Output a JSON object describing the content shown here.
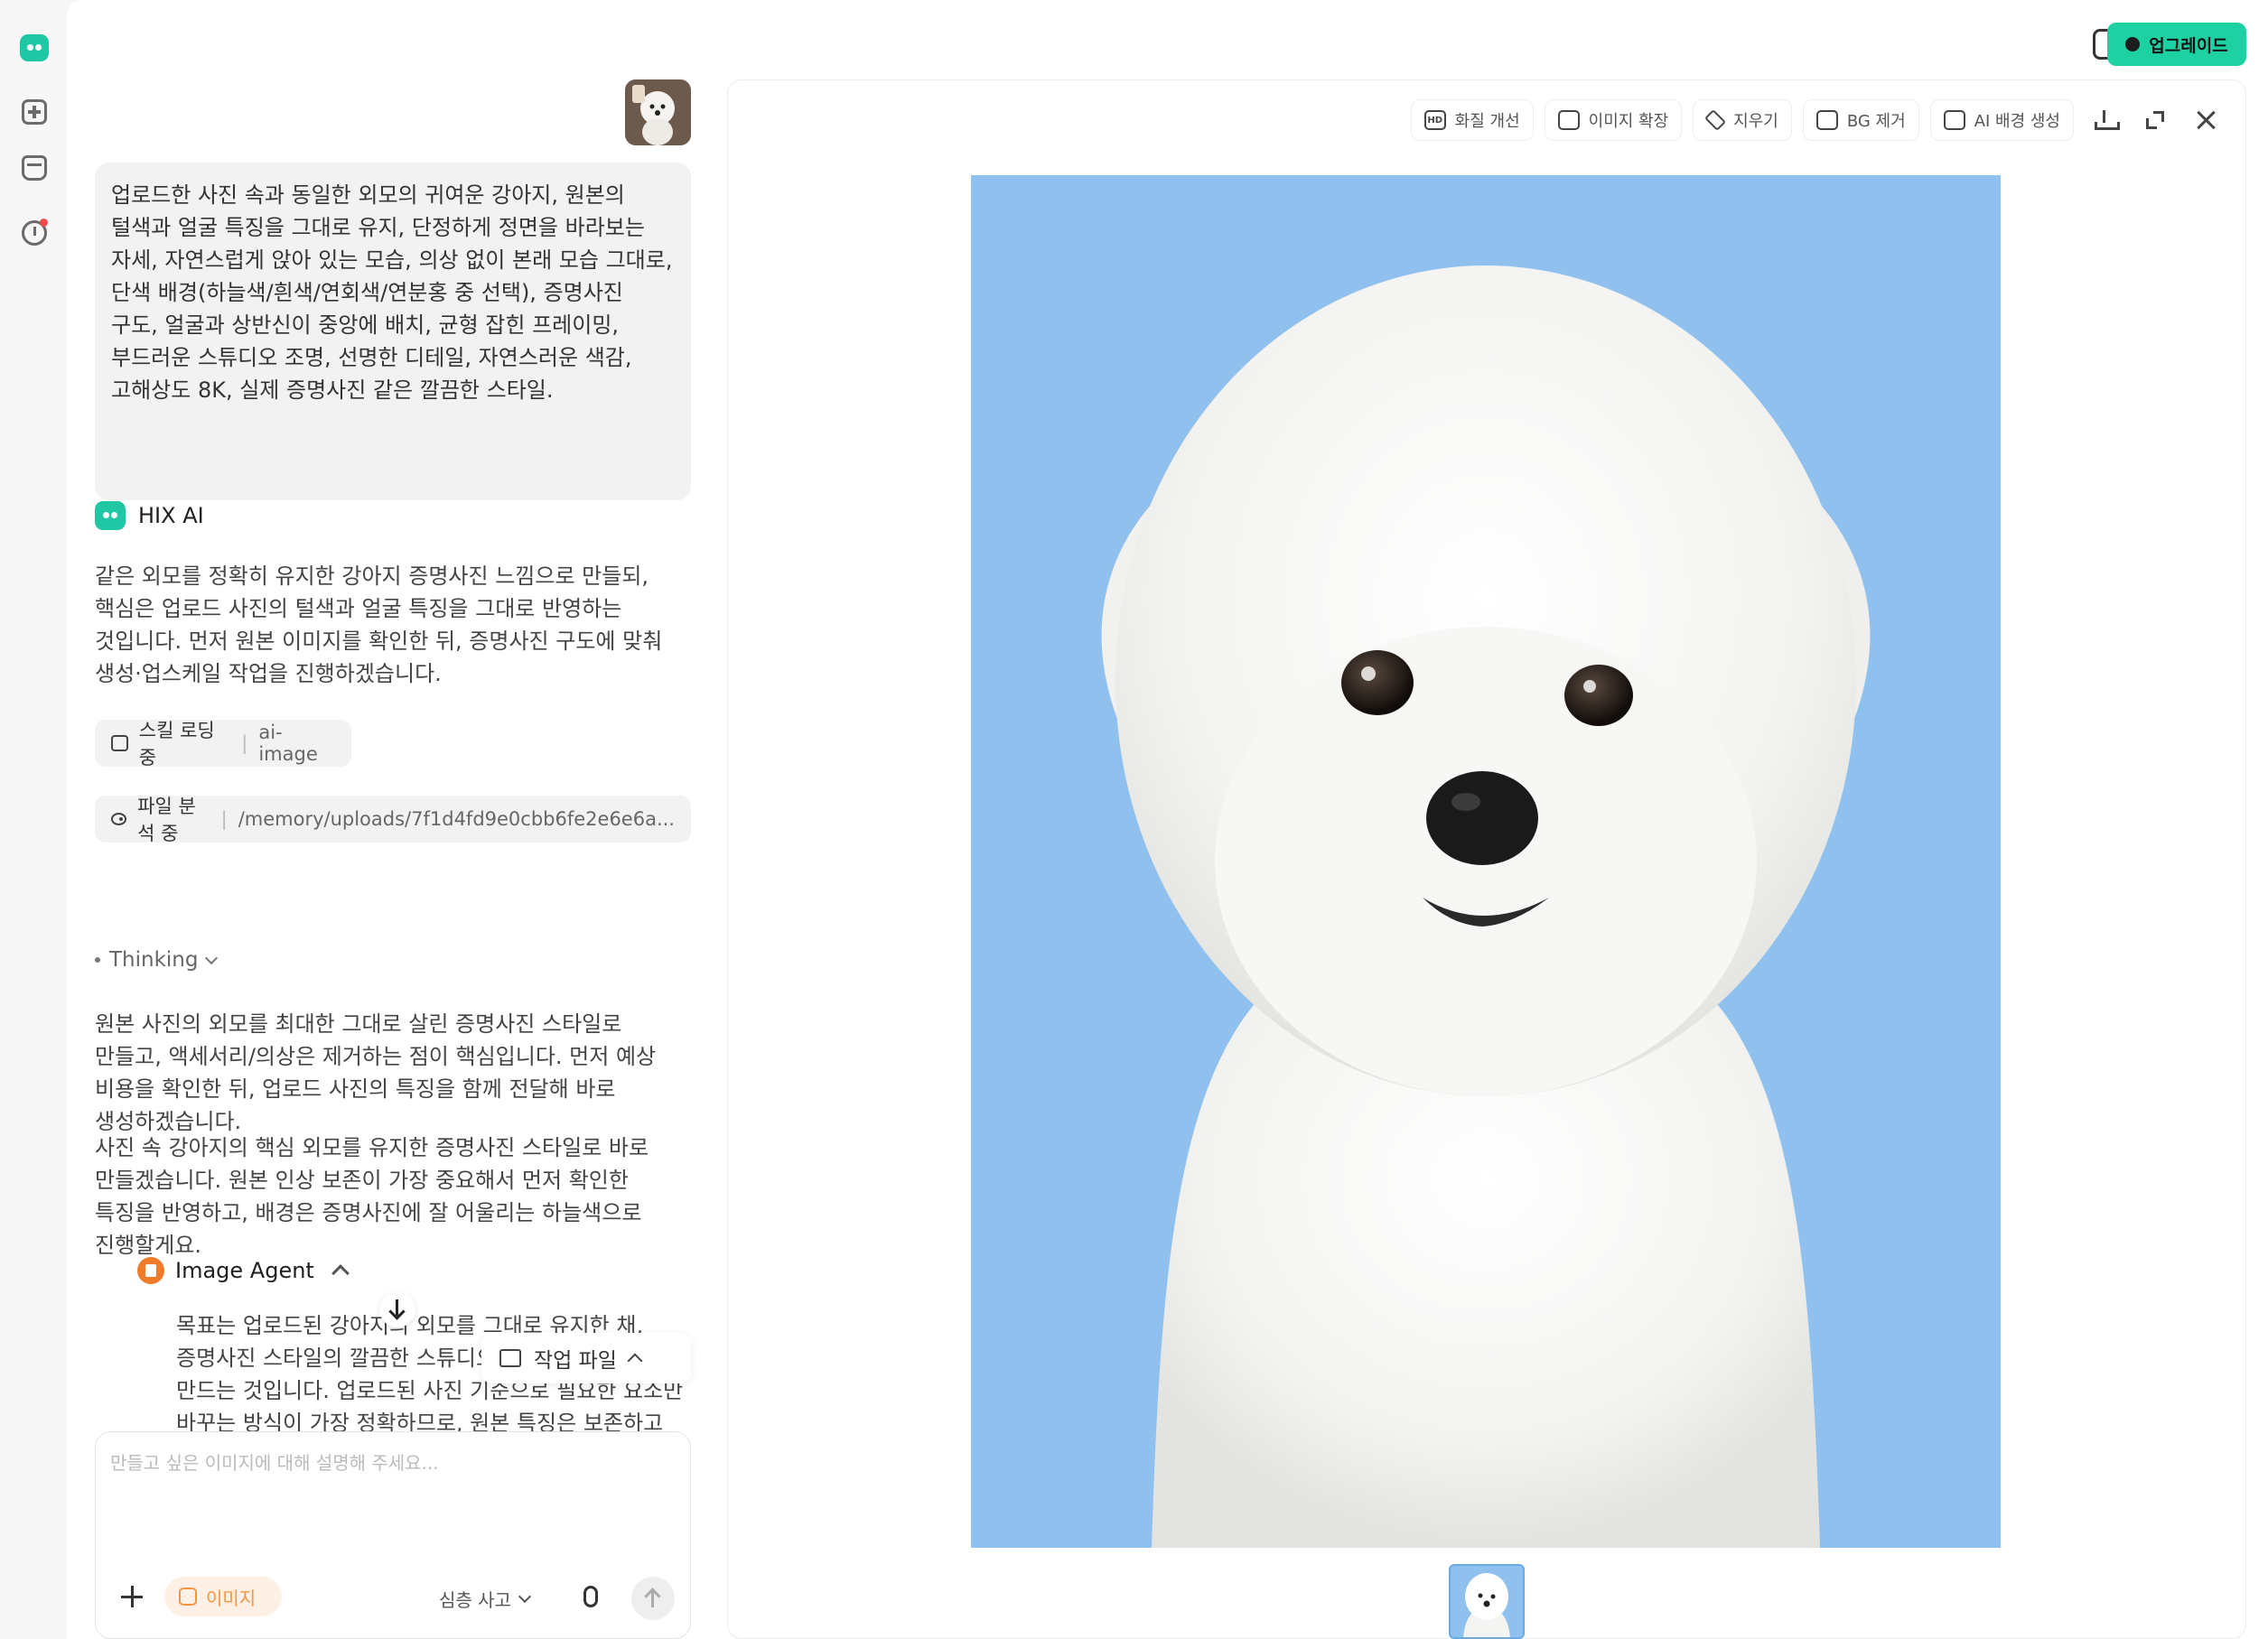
{
  "header": {
    "upgrade_label": "업그레이드"
  },
  "chat": {
    "user_message": "업로드한 사진 속과 동일한 외모의 귀여운 강아지, 원본의 털색과 얼굴 특징을 그대로 유지, 단정하게 정면을 바라보는 자세, 자연스럽게 앉아 있는 모습, 의상 없이 본래 모습 그대로, 단색 배경(하늘색/흰색/연회색/연분홍 중 선택), 증명사진 구도, 얼굴과 상반신이 중앙에 배치, 균형 잡힌 프레이밍, 부드러운 스튜디오 조명, 선명한 디테일, 자연스러운 색감, 고해상도 8K, 실제 증명사진 같은 깔끔한 스타일.",
    "ai_name": "HIX AI",
    "ai_paragraph_1": "같은 외모를 정확히 유지한 강아지 증명사진 느낌으로 만들되, 핵심은 업로드 사진의 털색과 얼굴 특징을 그대로 반영하는 것입니다. 먼저 원본 이미지를 확인한 뒤, 증명사진 구도에 맞춰 생성·업스케일 작업을 진행하겠습니다.",
    "skill_chip": {
      "label": "스킬 로딩 중",
      "value": "ai-image"
    },
    "file_chip": {
      "label": "파일 분석 중",
      "value": "/memory/uploads/7f1d4fd9e0cbb6fe2e6e6a..."
    },
    "thinking_label": "Thinking",
    "ai_paragraph_2": "원본 사진의 외모를 최대한 그대로 살린 증명사진 스타일로 만들고, 액세서리/의상은 제거하는 점이 핵심입니다. 먼저 예상 비용을 확인한 뒤, 업로드 사진의 특징을 함께 전달해 바로 생성하겠습니다.",
    "ai_paragraph_3": "사진 속 강아지의 핵심 외모를 유지한 증명사진 스타일로 바로 만들겠습니다. 원본 인상 보존이 가장 중요해서 먼저 확인한 특징을 반영하고, 배경은 증명사진에 잘 어울리는 하늘색으로 진행할게요.",
    "agent_name": "Image Agent",
    "agent_text": "목표는 업로드된 강아지의 외모를 그대로 유지한 채, 증명사진 스타일의 깔끔한 스튜디오 포트레이트 1장을 만드는 것입니다. 업로드된 사진 기준으로 필요한 요소만 바꾸는 방식이 가장 정확하므로, 원본 특징은 보존하고 배경·구도·의상만 정리해 생성하겠습니다.",
    "work_files_label": "작업 파일"
  },
  "composer": {
    "placeholder": "만들고 싶은 이미지에 대해 설명해 주세요...",
    "image_chip_label": "이미지",
    "deep_think_label": "심층 사고"
  },
  "viewer": {
    "tools": [
      {
        "icon_text": "HD",
        "label": "화질 개선"
      },
      {
        "icon_text": "",
        "label": "이미지 확장"
      },
      {
        "icon_text": "",
        "label": "지우기"
      },
      {
        "icon_text": "",
        "label": "BG 제거"
      },
      {
        "icon_text": "",
        "label": "AI 배경 생성"
      }
    ]
  },
  "colors": {
    "accent": "#1ed1a3",
    "image_background": "#8fc0ee",
    "notification_dot": "#f04b4b",
    "agent_icon": "#f07c2b"
  }
}
